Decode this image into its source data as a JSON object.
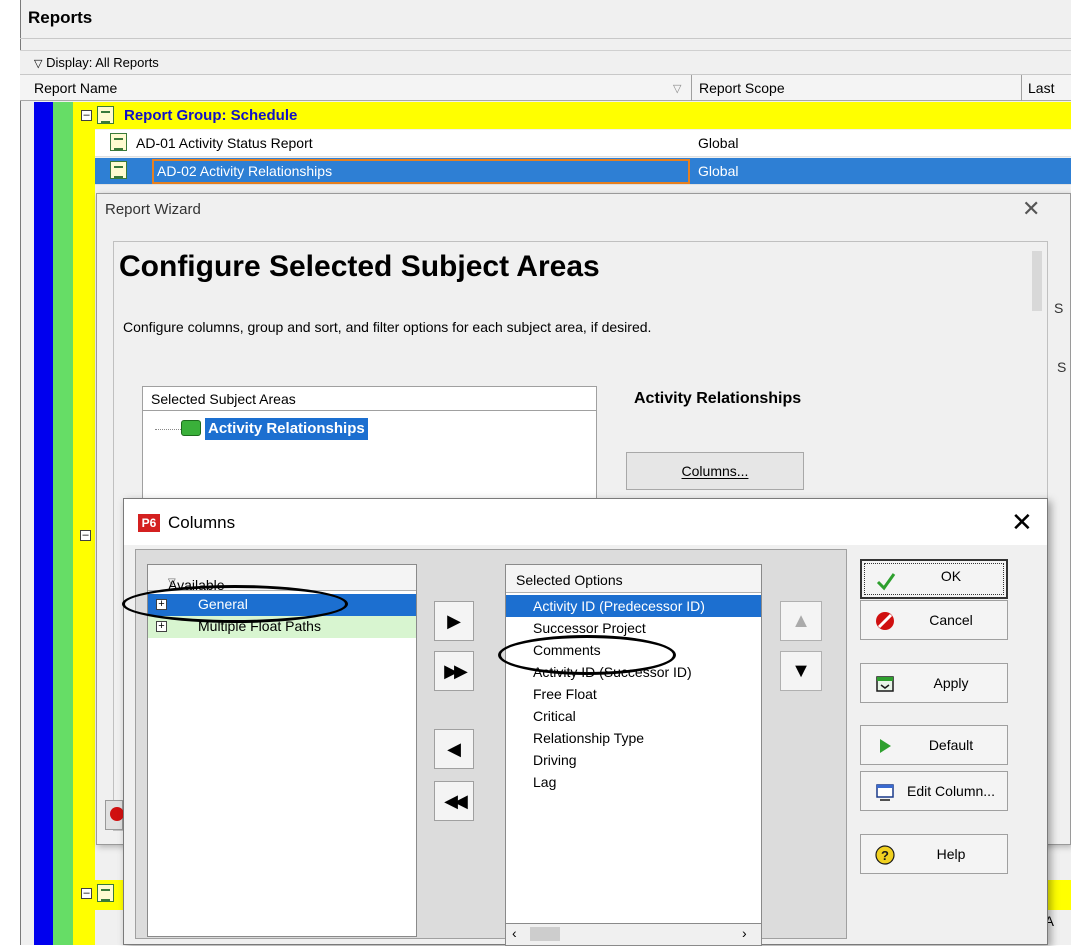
{
  "reports": {
    "title": "Reports",
    "display_label": "Display: All Reports",
    "columns": [
      "Report Name",
      "Report Scope",
      "Last"
    ],
    "group_label": "Report Group: Schedule",
    "rows": [
      {
        "name": "AD-01 Activity Status Report",
        "scope": "Global"
      },
      {
        "name": "AD-02  Activity Relationships",
        "scope": "Global"
      }
    ],
    "partial_right_text": "-A"
  },
  "wizard": {
    "title": "Report Wizard",
    "heading": "Configure Selected Subject Areas",
    "description": "Configure columns, group and sort, and filter options for each subject area, if desired.",
    "ssa_header": "Selected Subject Areas",
    "ssa_item": "Activity Relationships",
    "selected_area_label": "Activity Relationships",
    "columns_button": "Columns...",
    "right_partial": "S"
  },
  "columns_dialog": {
    "logo": "P6",
    "title": "Columns",
    "available_header": "Available Options",
    "available_items": [
      "General",
      "Multiple Float Paths"
    ],
    "selected_header": "Selected Options",
    "selected_items": [
      "Activity ID  (Predecessor ID)",
      "Successor Project",
      "Comments",
      "Activity ID  (Successor ID)",
      "Free Float",
      "Critical",
      "Relationship Type",
      "Driving",
      "Lag"
    ],
    "buttons": {
      "ok": "OK",
      "cancel": "Cancel",
      "apply": "Apply",
      "default": "Default",
      "edit_column": "Edit Column...",
      "help": "Help"
    }
  },
  "colors": {
    "selection_blue": "#1c6fd0",
    "group_yellow": "#ffff00",
    "stripe_blue": "#0000ee",
    "stripe_green": "#66dd66",
    "general_row_highlight": "#1c6fd0",
    "float_paths_row_bg": "#d8f5d0"
  }
}
